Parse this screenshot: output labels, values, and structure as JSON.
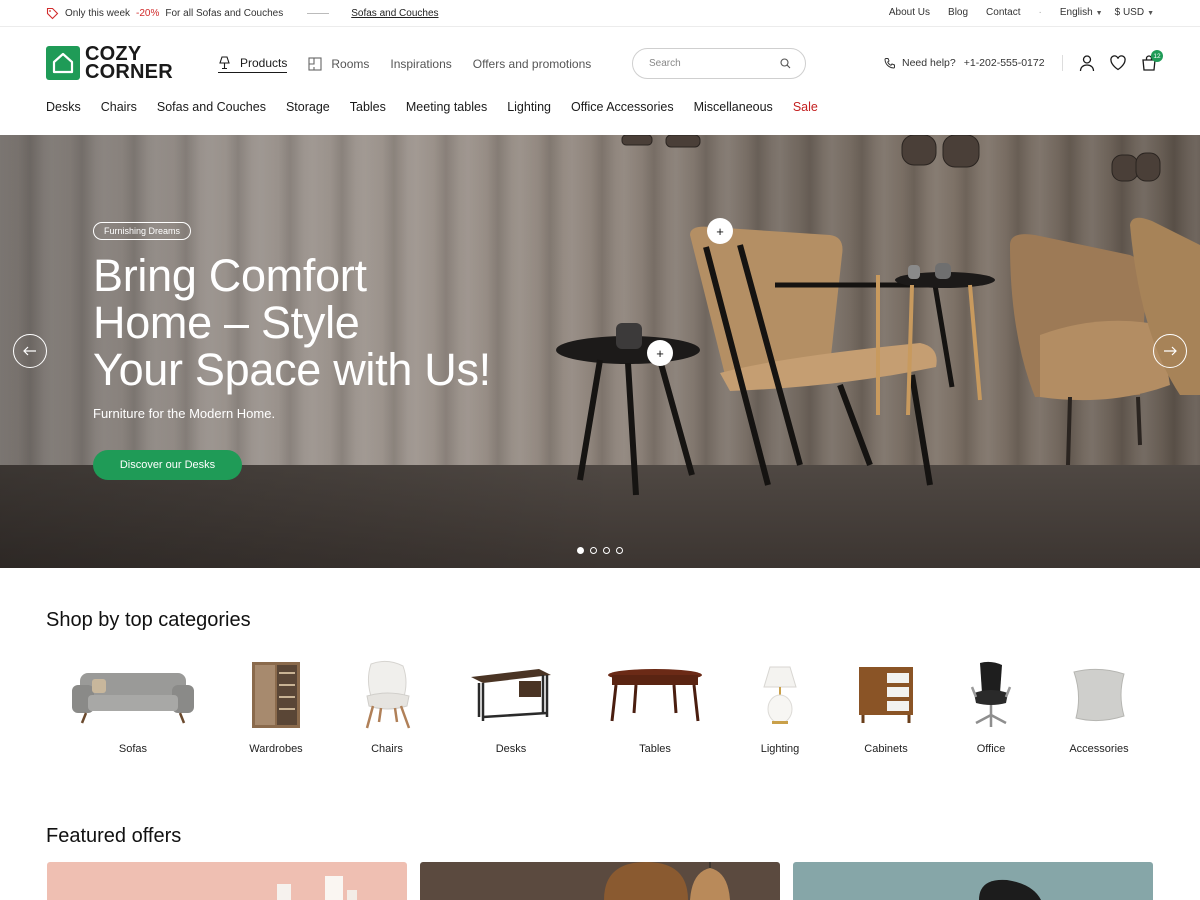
{
  "promo": {
    "prefix": "Only this week",
    "discount": "-20%",
    "text": "For all Sofas and Couches",
    "link": "Sofas and Couches"
  },
  "top_links": [
    "About Us",
    "Blog",
    "Contact"
  ],
  "language": "English",
  "currency": "$ USD",
  "logo": {
    "line1": "COZY",
    "line2": "CORNER"
  },
  "main_nav": [
    {
      "label": "Products",
      "icon": "lamp-icon"
    },
    {
      "label": "Rooms",
      "icon": "floorplan-icon"
    },
    {
      "label": "Inspirations"
    },
    {
      "label": "Offers and promotions"
    }
  ],
  "search": {
    "placeholder": "Search"
  },
  "help": {
    "label": "Need help?",
    "phone": "+1-202-555-0172"
  },
  "cart_count": "12",
  "categories_nav": [
    "Desks",
    "Chairs",
    "Sofas and Couches",
    "Storage",
    "Tables",
    "Meeting tables",
    "Lighting",
    "Office Accessories",
    "Miscellaneous",
    "Sale"
  ],
  "hero": {
    "badge": "Furnishing Dreams",
    "title_lines": [
      "Bring Comfort",
      "Home – Style",
      "Your Space with Us!"
    ],
    "subtitle": "Furniture for the Modern Home.",
    "cta": "Discover our Desks",
    "slides": 4,
    "active_slide": 1
  },
  "top_categories": {
    "title": "Shop by top categories",
    "items": [
      "Sofas",
      "Wardrobes",
      "Chairs",
      "Desks",
      "Tables",
      "Lighting",
      "Cabinets",
      "Office",
      "Accessories"
    ]
  },
  "featured": {
    "title": "Featured offers"
  },
  "colors": {
    "brand_green": "#1f9b57",
    "sale_red": "#c42020",
    "offer_pink": "#efbfb2",
    "offer_brown": "#5b4a3f",
    "offer_teal": "#86a6a8"
  }
}
